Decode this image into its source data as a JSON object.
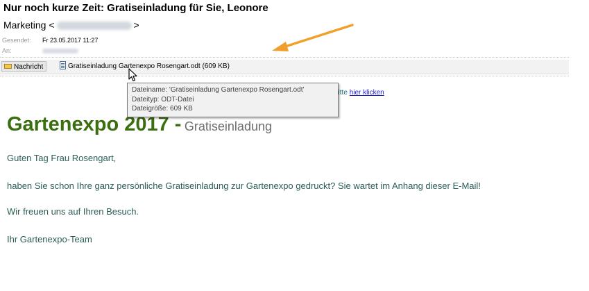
{
  "email": {
    "subject": "Nur noch kurze Zeit: Gratiseinladung für Sie, Leonore",
    "sender_name": "Marketing <",
    "sender_close": ">",
    "sent_label": "Gesendet:",
    "sent_value": "Fr 23.05.2017 11:27",
    "to_label": "An:"
  },
  "attachments": {
    "message_label": "Nachricht",
    "file_label": "Gratiseinladung Gartenexpo Rosengart.odt (609 KB)"
  },
  "tooltip": {
    "line1": "Dateiname: 'Gratiseinladung Gartenexpo Rosengart.odt'",
    "line2": "Dateityp: ODT-Datei",
    "line3": "Dateigröße: 609 KB"
  },
  "body": {
    "hint_prefix": "bitte",
    "hint_link": "hier klicken",
    "headline_big": "Gartenexpo 2017 -",
    "headline_small": "Gratiseinladung",
    "greeting": "Guten Tag Frau Rosengart,",
    "line1": "haben Sie schon Ihre ganz persönliche Gratiseinladung zur Gartenexpo gedruckt? Sie wartet im Anhang dieser E-Mail!",
    "line2": "Wir freuen uns auf Ihren Besuch.",
    "signature": "Ihr Gartenexpo-Team"
  },
  "colors": {
    "headline_green": "#3a6e0f",
    "body_text_teal": "#2a5d55",
    "annotation_arrow": "#f0a02a",
    "link_blue": "#1c1ccf"
  },
  "icons": {
    "message": "envelope-icon",
    "attachment": "document-icon",
    "pointer": "mouse-cursor-icon",
    "annotation": "orange-arrow-icon"
  }
}
